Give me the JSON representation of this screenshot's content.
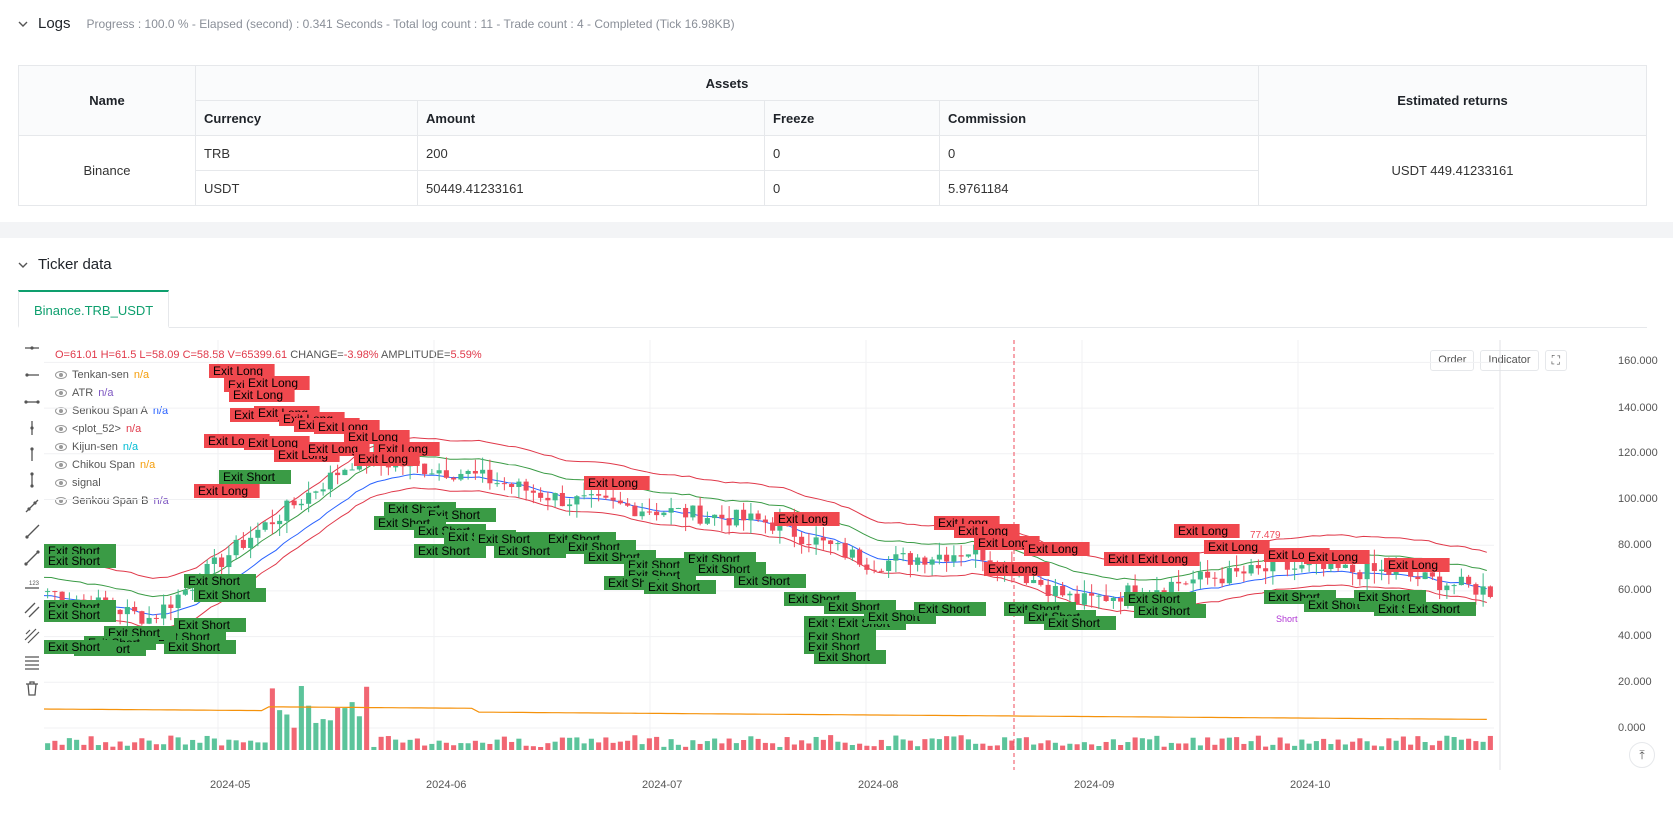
{
  "logs": {
    "title": "Logs",
    "status": "Progress : 100.0 % - Elapsed (second) : 0.341  Seconds - Total log count : 11 - Trade count : 4 - Completed (Tick 16.98KB)"
  },
  "assets_table": {
    "header_name": "Name",
    "header_assets": "Assets",
    "header_returns": "Estimated returns",
    "columns": [
      "Currency",
      "Amount",
      "Freeze",
      "Commission"
    ],
    "exchange": "Binance",
    "rows": [
      {
        "currency": "TRB",
        "amount": "200",
        "freeze": "0",
        "commission": "0"
      },
      {
        "currency": "USDT",
        "amount": "50449.41233161",
        "freeze": "0",
        "commission": "5.9761184"
      }
    ],
    "estimated_returns": "USDT 449.41233161"
  },
  "ticker": {
    "title": "Ticker data",
    "tab": "Binance.TRB_USDT"
  },
  "chart": {
    "ohlc": {
      "o": "O=61.01",
      "h": "H=61.5",
      "l": "L=58.09",
      "c": "C=58.58",
      "v": "V=65399.61",
      "change_label": "CHANGE=",
      "change": "-3.98%",
      "amp_label": "AMPLITUDE=",
      "amp": "5.59%"
    },
    "legend": [
      {
        "name": "Tenkan-sen",
        "value": "n/a",
        "color": "#f59e0b"
      },
      {
        "name": "ATR",
        "value": "n/a",
        "color": "#7e57c2"
      },
      {
        "name": "Senkou Span A",
        "value": "n/a",
        "color": "#2962ff"
      },
      {
        "name": "<plot_52>",
        "value": "n/a",
        "color": "#e0394a"
      },
      {
        "name": "Kijun-sen",
        "value": "n/a",
        "color": "#00bcd4"
      },
      {
        "name": "Chikou Span",
        "value": "n/a",
        "color": "#f59e0b"
      },
      {
        "name": "signal",
        "value": "",
        "color": "#555555"
      },
      {
        "name": "Senkou Span B",
        "value": "n/a",
        "color": "#7e57c2"
      }
    ],
    "buttons": {
      "order": "Order",
      "indicator": "Indicator"
    },
    "y_ticks": [
      "160.000",
      "140.000",
      "120.000",
      "100.000",
      "80.000",
      "60.000",
      "40.000",
      "20.000",
      "0.000"
    ],
    "x_ticks": [
      "2024-05",
      "2024-06",
      "2024-07",
      "2024-08",
      "2024-09",
      "2024-10"
    ],
    "marker_labels": {
      "exit_long": "Exit Long",
      "exit_short": "Exit Short",
      "short": "Short",
      "price_tag": "77.479"
    },
    "colors": {
      "up": "#3fba8a",
      "down": "#ef4b5b",
      "exit_long_bg": "#f0484e",
      "exit_short_bg": "#3a9b45",
      "atr": "#f5920b"
    }
  },
  "chart_data": {
    "type": "candlestick",
    "x_ticks": [
      "2024-05",
      "2024-06",
      "2024-07",
      "2024-08",
      "2024-09",
      "2024-10"
    ],
    "ylim": [
      0,
      160
    ],
    "close_trend": [
      {
        "x": "2024-04-20",
        "y": 60
      },
      {
        "x": "2024-04-25",
        "y": 48
      },
      {
        "x": "2024-05-01",
        "y": 85
      },
      {
        "x": "2024-05-05",
        "y": 118
      },
      {
        "x": "2024-05-15",
        "y": 112
      },
      {
        "x": "2024-06-01",
        "y": 100
      },
      {
        "x": "2024-06-15",
        "y": 95
      },
      {
        "x": "2024-07-01",
        "y": 90
      },
      {
        "x": "2024-07-15",
        "y": 72
      },
      {
        "x": "2024-08-01",
        "y": 78
      },
      {
        "x": "2024-08-15",
        "y": 55
      },
      {
        "x": "2024-09-01",
        "y": 64
      },
      {
        "x": "2024-09-15",
        "y": 70
      },
      {
        "x": "2024-10-01",
        "y": 68
      },
      {
        "x": "2024-10-20",
        "y": 60
      }
    ],
    "atr_level": {
      "start": 10,
      "end": 4.5
    }
  }
}
